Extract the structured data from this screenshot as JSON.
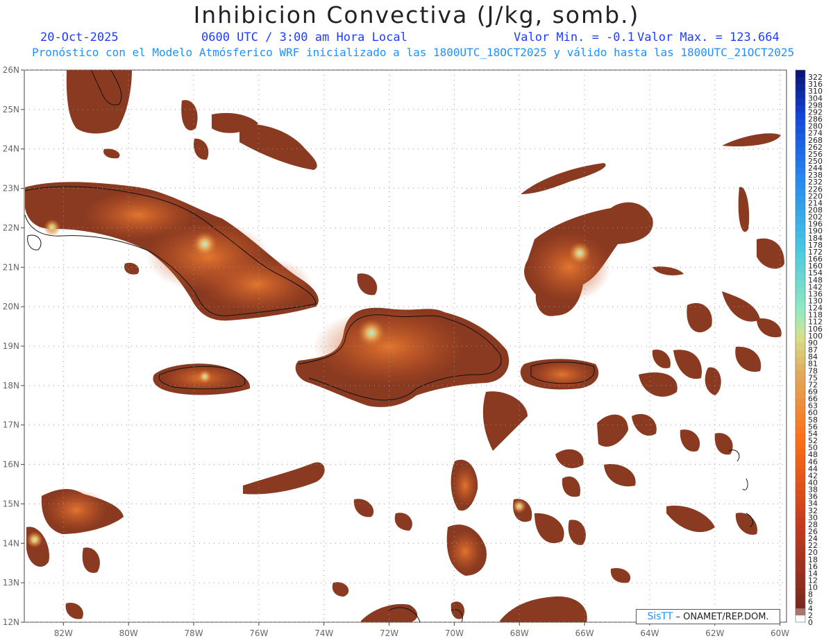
{
  "header": {
    "title": "Inhibicion Convectiva (J/kg, somb.)",
    "date": "20-Oct-2025",
    "time": "0600 UTC / 3:00 am Hora Local",
    "min_label": "Valor Min. = -0.1",
    "max_label": "Valor Max. = 123.664",
    "forecast_line": "Pronóstico con el Modelo Atmósferico WRF inicializado a las 1800UTC_18OCT2025 y válido hasta las  1800UTC_21OCT2025"
  },
  "map": {
    "lon_range": [
      -83.2,
      -59.8
    ],
    "lat_range": [
      12,
      26
    ],
    "lon_ticks": [
      "82W",
      "80W",
      "78W",
      "76W",
      "74W",
      "72W",
      "70W",
      "68W",
      "66W",
      "64W",
      "62W",
      "60W"
    ],
    "lon_tick_values": [
      -82,
      -80,
      -78,
      -76,
      -74,
      -72,
      -70,
      -68,
      -66,
      -64,
      -62,
      -60
    ],
    "lat_ticks": [
      "12N",
      "13N",
      "14N",
      "15N",
      "16N",
      "17N",
      "18N",
      "19N",
      "20N",
      "21N",
      "22N",
      "23N",
      "24N",
      "25N",
      "26N"
    ],
    "lat_tick_values": [
      12,
      13,
      14,
      15,
      16,
      17,
      18,
      19,
      20,
      21,
      22,
      23,
      24,
      25,
      26
    ],
    "field_color": "#8a3a20",
    "grid": true
  },
  "colorbar": {
    "labels": [
      "0",
      "2",
      "4",
      "6",
      "8",
      "10",
      "12",
      "14",
      "16",
      "18",
      "20",
      "22",
      "24",
      "26",
      "28",
      "30",
      "32",
      "34",
      "36",
      "38",
      "40",
      "42",
      "44",
      "46",
      "48",
      "50",
      "52",
      "54",
      "56",
      "58",
      "60",
      "63",
      "66",
      "69",
      "72",
      "75",
      "78",
      "81",
      "84",
      "87",
      "90",
      "100",
      "106",
      "112",
      "118",
      "124",
      "130",
      "136",
      "142",
      "148",
      "154",
      "160",
      "166",
      "172",
      "178",
      "184",
      "190",
      "196",
      "202",
      "208",
      "214",
      "220",
      "226",
      "232",
      "238",
      "244",
      "250",
      "256",
      "262",
      "268",
      "274",
      "280",
      "286",
      "292",
      "298",
      "304",
      "310",
      "316",
      "322"
    ]
  },
  "credit": {
    "brand": "SisTT",
    "text": " – ONAMET/REP.DOM."
  }
}
